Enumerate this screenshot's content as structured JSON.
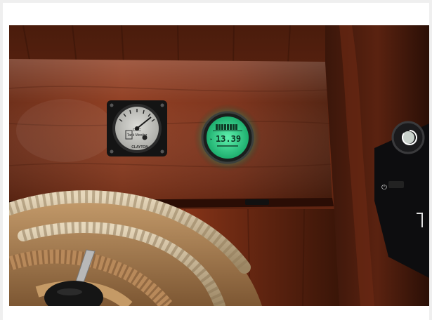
{
  "photo": {
    "subject": "boat-cabin-instrument-panel"
  },
  "analog_gauge": {
    "face_label_line1": "DMC",
    "face_label_line2": "Tank Monitor",
    "brand": "CLAYTON"
  },
  "battery_monitor": {
    "reading": "13.39",
    "display_color": "#3df5a0",
    "glow_color": "#1bd486"
  },
  "colors": {
    "wood_dark": "#3a160a",
    "wood_mid": "#7a2e16",
    "wood_light": "#a9482a",
    "rope": "#d9c7a7"
  }
}
